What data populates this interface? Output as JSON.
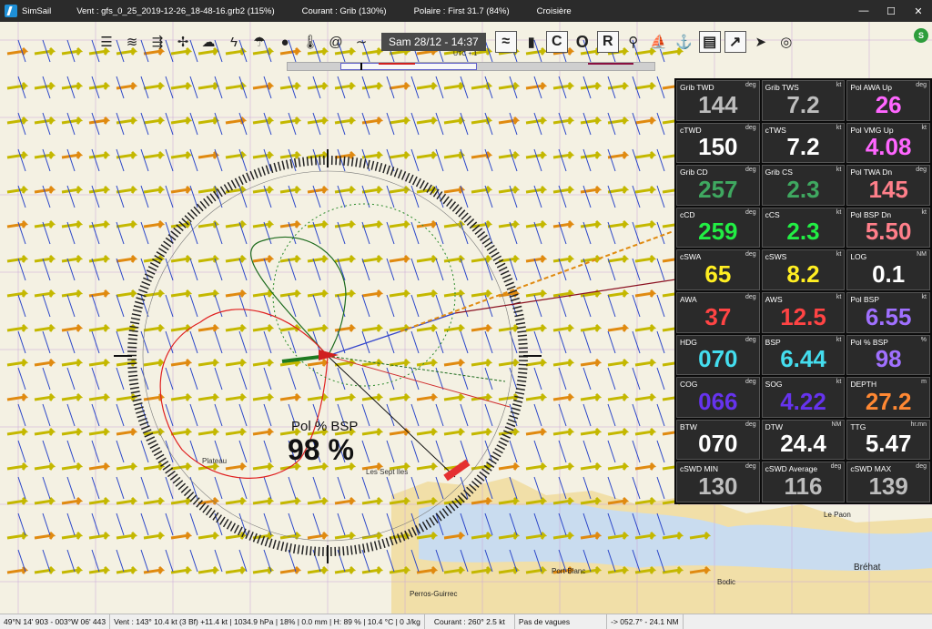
{
  "window": {
    "app_name": "SimSail",
    "wind_file": "Vent : gfs_0_25_2019-12-26_18-48-16.grb2 (115%)",
    "current": "Courant : Grib (130%)",
    "polar": "Polaire : First 31.7 (84%)",
    "mode": "Croisière",
    "controls": [
      "—",
      "☐",
      "✕"
    ]
  },
  "toolbar": {
    "date": "Sam 28/12 - 14:37",
    "utc": "UTC + 1",
    "letters": [
      "C",
      "O",
      "R"
    ]
  },
  "chart": {
    "pol_bsp_label": "Pol % BSP",
    "pol_bsp_value": "98 %"
  },
  "panel": [
    {
      "label": "Grib TWD",
      "unit": "deg",
      "value": "144",
      "color": "#bdbdbd"
    },
    {
      "label": "Grib TWS",
      "unit": "kt",
      "value": "7.2",
      "color": "#bdbdbd"
    },
    {
      "label": "Pol AWA Up",
      "unit": "deg",
      "value": "26",
      "color": "#ff66ff"
    },
    {
      "label": "cTWD",
      "unit": "deg",
      "value": "150",
      "color": "#ffffff"
    },
    {
      "label": "cTWS",
      "unit": "kt",
      "value": "7.2",
      "color": "#ffffff"
    },
    {
      "label": "Pol VMG Up",
      "unit": "kt",
      "value": "4.08",
      "color": "#ff66ff"
    },
    {
      "label": "Grib CD",
      "unit": "deg",
      "value": "257",
      "color": "#3fa860"
    },
    {
      "label": "Grib CS",
      "unit": "kt",
      "value": "2.3",
      "color": "#3fa860"
    },
    {
      "label": "Pol TWA Dn",
      "unit": "deg",
      "value": "145",
      "color": "#ff7f8a"
    },
    {
      "label": "cCD",
      "unit": "deg",
      "value": "259",
      "color": "#22ee44"
    },
    {
      "label": "cCS",
      "unit": "kt",
      "value": "2.3",
      "color": "#22ee44"
    },
    {
      "label": "Pol BSP Dn",
      "unit": "kt",
      "value": "5.50",
      "color": "#ff7f8a"
    },
    {
      "label": "cSWA",
      "unit": "deg",
      "value": "65",
      "color": "#ffee22"
    },
    {
      "label": "cSWS",
      "unit": "kt",
      "value": "8.2",
      "color": "#ffee22"
    },
    {
      "label": "LOG",
      "unit": "NM",
      "value": "0.1",
      "color": "#ffffff"
    },
    {
      "label": "AWA",
      "unit": "deg",
      "value": "37",
      "color": "#ff4444"
    },
    {
      "label": "AWS",
      "unit": "kt",
      "value": "12.5",
      "color": "#ff4444"
    },
    {
      "label": "Pol BSP",
      "unit": "kt",
      "value": "6.55",
      "color": "#a070ff"
    },
    {
      "label": "HDG",
      "unit": "deg",
      "value": "070",
      "color": "#44ddee"
    },
    {
      "label": "BSP",
      "unit": "kt",
      "value": "6.44",
      "color": "#44ddee"
    },
    {
      "label": "Pol % BSP",
      "unit": "%",
      "value": "98",
      "color": "#a070ff"
    },
    {
      "label": "COG",
      "unit": "deg",
      "value": "066",
      "color": "#6633ee"
    },
    {
      "label": "SOG",
      "unit": "kt",
      "value": "4.22",
      "color": "#6633ee"
    },
    {
      "label": "DEPTH",
      "unit": "m",
      "value": "27.2",
      "color": "#ff8833"
    },
    {
      "label": "BTW",
      "unit": "deg",
      "value": "070",
      "color": "#ffffff"
    },
    {
      "label": "DTW",
      "unit": "NM",
      "value": "24.4",
      "color": "#ffffff"
    },
    {
      "label": "TTG",
      "unit": "hr.mn",
      "value": "5.47",
      "color": "#ffffff"
    },
    {
      "label": "cSWD MIN",
      "unit": "deg",
      "value": "130",
      "color": "#bdbdbd"
    },
    {
      "label": "cSWD Average",
      "unit": "deg",
      "value": "116",
      "color": "#bdbdbd"
    },
    {
      "label": "cSWD MAX",
      "unit": "deg",
      "value": "139",
      "color": "#bdbdbd"
    }
  ],
  "map_labels": [
    "Les Sept Iles",
    "Bréhat",
    "Le Paon",
    "Port-Blanc",
    "Perros-Guirrec",
    "Bodic",
    "Plateau"
  ],
  "status": {
    "position": "49°N 14' 903 - 003°W 06' 443",
    "wind": "Vent : 143° 10.4 kt (3 Bf) +11.4 kt | 1034.9 hPa | 18% | 0.0 mm | H: 89 % | 10.4 °C | 0 J/kg",
    "current": "Courant : 260° 2.5 kt",
    "waves": "Pas de vagues",
    "route": "-> 052.7° - 24.1 NM"
  }
}
